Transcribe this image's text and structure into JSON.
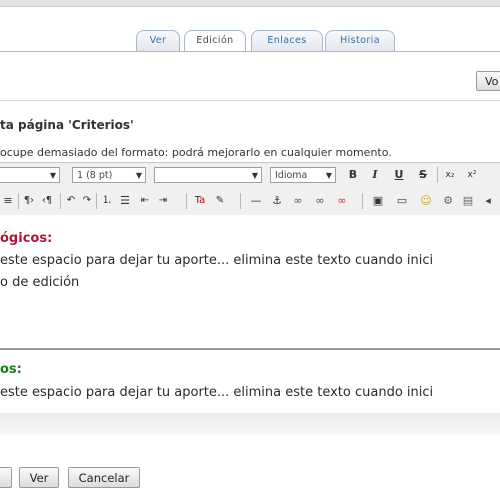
{
  "tabs": [
    "Ver",
    "Edición",
    "Enlaces",
    "Historia"
  ],
  "top_button_label": "Vo",
  "heading": "ta página 'Criterios'",
  "note": "ocupe demasiado del formato: podrá mejorarlo en cualquier momento.",
  "toolbar": {
    "font_size": "1 (8 pt)",
    "font_name": "",
    "language": "Idioma",
    "bold": "B",
    "italic": "I",
    "underline": "U",
    "strike": "S"
  },
  "editor": {
    "section1_title": "ógicos:",
    "section1_line1": "este espacio para dejar tu aporte... elimina este texto cuando inici",
    "section1_line2": "o de edición",
    "section2_title": "os:",
    "section2_line1": "este espacio para dejar tu aporte... elimina este texto cuando inici"
  },
  "buttons": {
    "ver": "Ver",
    "cancelar": "Cancelar"
  }
}
